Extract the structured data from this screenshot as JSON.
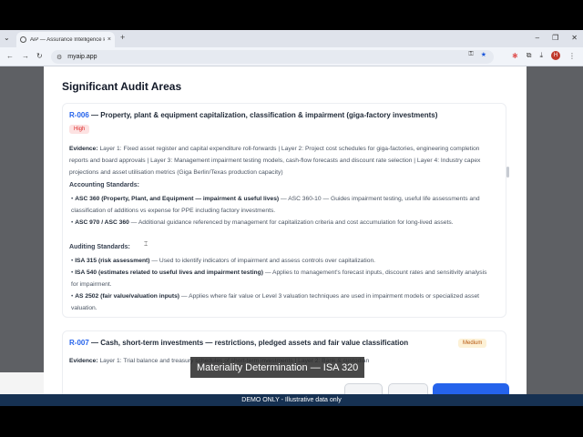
{
  "browser": {
    "tab_title": "AiP — Assurance Intelligence P",
    "tab_close": "×",
    "new_tab": "+",
    "url": "myaip.app",
    "window_controls": {
      "minimize": "–",
      "restore": "❐",
      "close": "✕"
    }
  },
  "page": {
    "title": "Significant Audit Areas",
    "risk1": {
      "id": "R-006",
      "title": " — Property, plant & equipment capitalization, classification & impairment (giga-factory investments)",
      "badge": "High",
      "evidence_label": "Evidence:",
      "evidence_text": " Layer 1: Fixed asset register and capital expenditure roll-forwards | Layer 2: Project cost schedules for giga-factories, engineering completion reports and board approvals | Layer 3: Management impairment testing models, cash-flow forecasts and discount rate selection | Layer 4: Industry capex projections and asset utilisation metrics (Giga Berlin/Texas production capacity)",
      "accounting_label": "Accounting Standards:",
      "accounting": [
        {
          "name": "ASC 360 (Property, Plant, and Equipment — impairment & useful lives)",
          "text": " — ASC 360-10 — Guides impairment testing, useful life assessments and classification of additions vs expense for PPE including factory investments."
        },
        {
          "name": "ASC 970 / ASC 360",
          "text": " — Additional guidance referenced by management for capitalization criteria and cost accumulation for long-lived assets."
        }
      ],
      "auditing_label": "Auditing Standards:",
      "auditing": [
        {
          "name": "ISA 315 (risk assessment)",
          "text": " — Used to identify indicators of impairment and assess controls over capitalization."
        },
        {
          "name": "ISA 540 (estimates related to useful lives and impairment testing)",
          "text": " — Applies to management's forecast inputs, discount rates and sensitivity analysis for impairment."
        },
        {
          "name": "AS 2502 (fair value/valuation inputs)",
          "text": " — Applies where fair value or Level 3 valuation techniques are used in impairment models or specialized asset valuation."
        }
      ]
    },
    "risk2": {
      "id": "R-007",
      "title": " — Cash, short-term investments — restrictions, pledged assets and fair value classification",
      "badge": "Medium",
      "evidence_label": "Evidence:",
      "evidence_text": " Layer 1: Trial balance and treasury schedules of short-term investments | Layer 2: Bank & custodian"
    }
  },
  "overlay": {
    "caption": "Materiality Determination — ISA 320"
  },
  "footer": {
    "text": "DEMO ONLY  -  Illustrative data only"
  }
}
